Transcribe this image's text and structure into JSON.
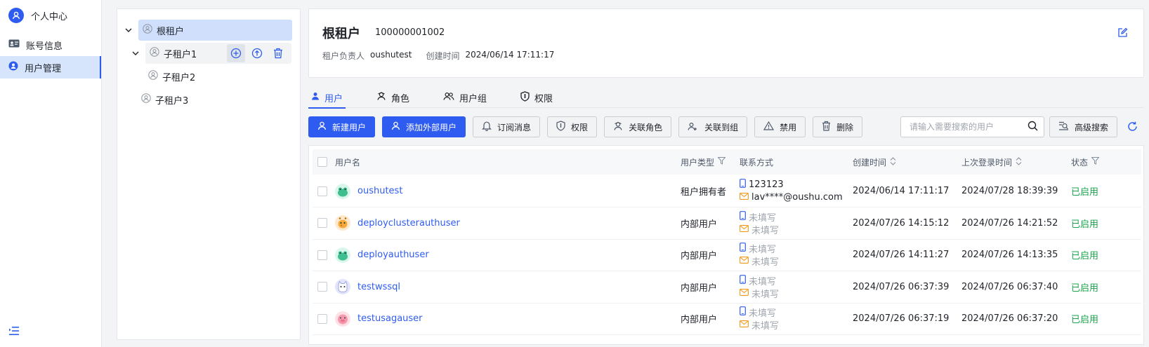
{
  "nav": {
    "header": "个人中心",
    "items": [
      {
        "label": "账号信息",
        "icon": "id-card-icon",
        "active": false
      },
      {
        "label": "用户管理",
        "icon": "user-manage-icon",
        "active": true
      }
    ]
  },
  "tree": {
    "nodes": [
      {
        "label": "根租户",
        "level": 0,
        "expanded": true,
        "selected": true
      },
      {
        "label": "子租户1",
        "level": 1,
        "expanded": true,
        "hovered": true
      },
      {
        "label": "子租户2",
        "level": 2
      },
      {
        "label": "子租户3",
        "level": 1
      }
    ]
  },
  "tenant": {
    "name": "根租户",
    "id": "100000001002",
    "owner_label": "租户负责人",
    "owner": "oushutest",
    "created_label": "创建时间",
    "created": "2024/06/14 17:11:17"
  },
  "tabs": [
    {
      "label": "用户",
      "icon": "user-icon",
      "active": true
    },
    {
      "label": "角色",
      "icon": "role-icon",
      "active": false
    },
    {
      "label": "用户组",
      "icon": "group-icon",
      "active": false
    },
    {
      "label": "权限",
      "icon": "shield-icon",
      "active": false
    }
  ],
  "toolbar": {
    "new_user": "新建用户",
    "add_external": "添加外部用户",
    "subscribe": "订阅消息",
    "permission": "权限",
    "link_role": "关联角色",
    "link_group": "关联到组",
    "disable": "禁用",
    "delete": "删除",
    "search_placeholder": "请输入需要搜索的用户",
    "advanced_search": "高级搜索"
  },
  "table": {
    "columns": {
      "username": "用户名",
      "type": "用户类型",
      "contact": "联系方式",
      "created": "创建时间",
      "last_login": "上次登录时间",
      "status": "状态"
    },
    "rows": [
      {
        "username": "oushutest",
        "avatar": "frog",
        "type": "租户拥有者",
        "phone": "123123",
        "email": "lav****@oushu.com",
        "created": "2024/06/14 17:11:17",
        "last_login": "2024/07/28 18:39:39",
        "status": "已启用"
      },
      {
        "username": "deployclusterauthuser",
        "avatar": "giraffe",
        "type": "内部用户",
        "phone": "未填写",
        "email": "未填写",
        "created": "2024/07/26 14:15:12",
        "last_login": "2024/07/26 14:21:52",
        "status": "已启用"
      },
      {
        "username": "deployauthuser",
        "avatar": "frog",
        "type": "内部用户",
        "phone": "未填写",
        "email": "未填写",
        "created": "2024/07/26 14:11:27",
        "last_login": "2024/07/26 14:13:35",
        "status": "已启用"
      },
      {
        "username": "testwssql",
        "avatar": "cat",
        "type": "内部用户",
        "phone": "未填写",
        "email": "未填写",
        "created": "2024/07/26 06:37:39",
        "last_login": "2024/07/26 06:37:40",
        "status": "已启用"
      },
      {
        "username": "testusagauser",
        "avatar": "pig",
        "type": "内部用户",
        "phone": "未填写",
        "email": "未填写",
        "created": "2024/07/26 06:37:19",
        "last_login": "2024/07/26 06:37:20",
        "status": "已启用"
      }
    ]
  },
  "colors": {
    "primary": "#2f5cf0",
    "enabled": "#1aa34a",
    "selected_bg": "#cfdffc"
  }
}
